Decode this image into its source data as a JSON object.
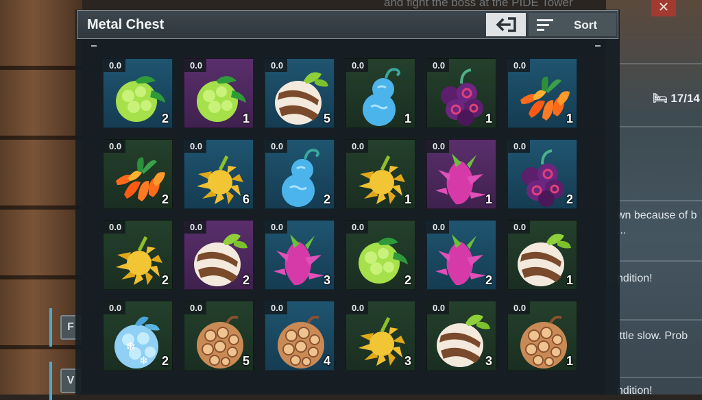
{
  "background": {
    "quest_text": "and fight the boss at the PIDE Tower",
    "bed_count": "17/14",
    "chat": [
      "wn because of b",
      "...",
      "ndition!",
      "ittle slow. Prob",
      "ndition!"
    ],
    "key_hints": [
      "F",
      "V"
    ]
  },
  "chest": {
    "title": "Metal Chest",
    "exit_icon": "exit-arrow-icon",
    "sort_label": "Sort",
    "sort_icon": "sort-lines-icon"
  },
  "colors": {
    "slot_blue": "#1f5570",
    "slot_purple": "#5a2f6c",
    "slot_green": "#24402c",
    "panel": "#161e24"
  },
  "slots": [
    {
      "weight": "0.0",
      "qty": "2",
      "item": "green-fruit",
      "bg": "blue"
    },
    {
      "weight": "0.0",
      "qty": "1",
      "item": "green-fruit",
      "bg": "purple"
    },
    {
      "weight": "0.0",
      "qty": "5",
      "item": "striped-fruit",
      "bg": "blue"
    },
    {
      "weight": "0.0",
      "qty": "1",
      "item": "blue-gourd-fruit",
      "bg": "green"
    },
    {
      "weight": "0.0",
      "qty": "1",
      "item": "purple-grape-fruit",
      "bg": "green"
    },
    {
      "weight": "0.0",
      "qty": "1",
      "item": "orange-flame-fruit",
      "bg": "blue"
    },
    {
      "weight": "0.0",
      "qty": "2",
      "item": "orange-flame-fruit",
      "bg": "green"
    },
    {
      "weight": "0.0",
      "qty": "6",
      "item": "yellow-spike-fruit",
      "bg": "blue"
    },
    {
      "weight": "0.0",
      "qty": "2",
      "item": "blue-gourd-fruit",
      "bg": "blue"
    },
    {
      "weight": "0.0",
      "qty": "1",
      "item": "yellow-spike-fruit",
      "bg": "green"
    },
    {
      "weight": "0.0",
      "qty": "1",
      "item": "pink-dragon-fruit",
      "bg": "purple"
    },
    {
      "weight": "0.0",
      "qty": "2",
      "item": "purple-grape-fruit",
      "bg": "blue"
    },
    {
      "weight": "0.0",
      "qty": "2",
      "item": "yellow-spike-fruit",
      "bg": "green"
    },
    {
      "weight": "0.0",
      "qty": "2",
      "item": "striped-fruit",
      "bg": "purple"
    },
    {
      "weight": "0.0",
      "qty": "3",
      "item": "pink-dragon-fruit",
      "bg": "blue"
    },
    {
      "weight": "0.0",
      "qty": "2",
      "item": "green-fruit",
      "bg": "green"
    },
    {
      "weight": "0.0",
      "qty": "2",
      "item": "pink-dragon-fruit",
      "bg": "blue"
    },
    {
      "weight": "0.0",
      "qty": "1",
      "item": "striped-fruit",
      "bg": "green"
    },
    {
      "weight": "0.0",
      "qty": "2",
      "item": "ice-fruit",
      "bg": "green"
    },
    {
      "weight": "0.0",
      "qty": "5",
      "item": "brown-shell-fruit",
      "bg": "green"
    },
    {
      "weight": "0.0",
      "qty": "4",
      "item": "brown-shell-fruit",
      "bg": "blue"
    },
    {
      "weight": "0.0",
      "qty": "3",
      "item": "yellow-spike-fruit",
      "bg": "green"
    },
    {
      "weight": "0.0",
      "qty": "3",
      "item": "striped-fruit",
      "bg": "green"
    },
    {
      "weight": "0.0",
      "qty": "1",
      "item": "brown-shell-fruit",
      "bg": "green"
    }
  ]
}
